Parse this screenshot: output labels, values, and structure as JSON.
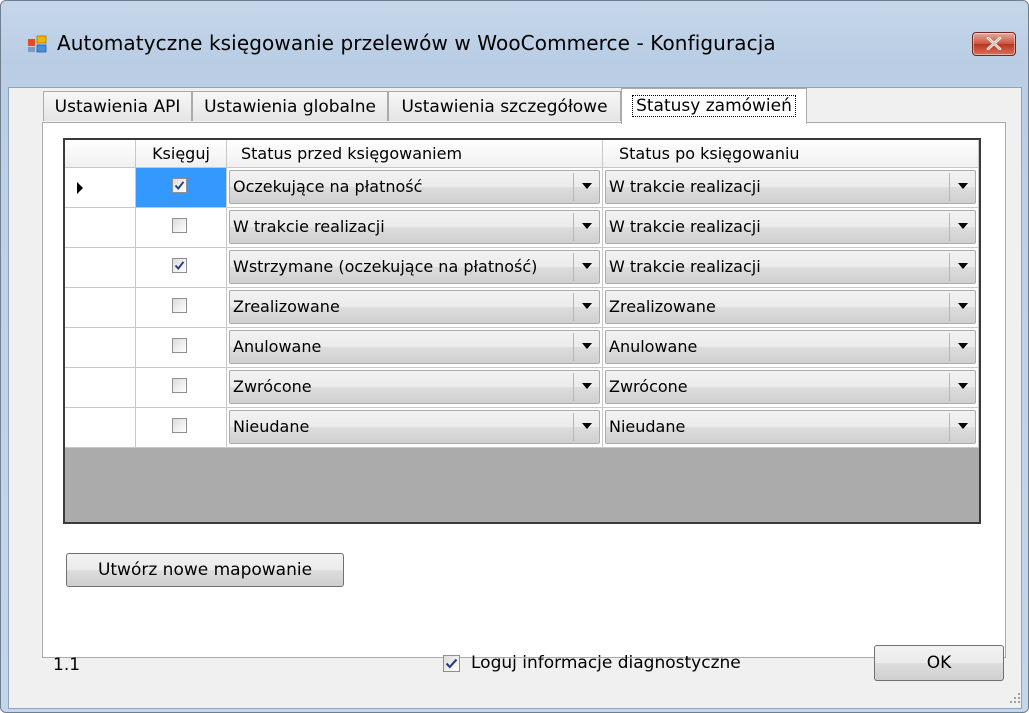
{
  "window": {
    "title": "Automatyczne księgowanie przelewów w WooCommerce - Konfiguracja",
    "icon": "app-window-icon",
    "close_icon": "close-icon"
  },
  "tabs": [
    {
      "label": "Ustawienia API",
      "active": false
    },
    {
      "label": "Ustawienia globalne",
      "active": false
    },
    {
      "label": "Ustawienia szczegółowe",
      "active": false
    },
    {
      "label": "Statusy zamówień",
      "active": true
    }
  ],
  "grid": {
    "columns": {
      "book": "Księguj",
      "status_before": "Status przed księgowaniem",
      "status_after": "Status po księgowaniu"
    },
    "current_row_indicator": "row-pointer-icon",
    "rows": [
      {
        "book": true,
        "before": "Oczekujące na płatność",
        "after": "W trakcie realizacji"
      },
      {
        "book": false,
        "before": "W trakcie realizacji",
        "after": "W trakcie realizacji"
      },
      {
        "book": true,
        "before": "Wstrzymane (oczekujące na płatność)",
        "after": "W trakcie realizacji"
      },
      {
        "book": false,
        "before": "Zrealizowane",
        "after": "Zrealizowane"
      },
      {
        "book": false,
        "before": "Anulowane",
        "after": "Anulowane"
      },
      {
        "book": false,
        "before": "Zwrócone",
        "after": "Zwrócone"
      },
      {
        "book": false,
        "before": "Nieudane",
        "after": "Nieudane"
      }
    ]
  },
  "new_mapping_button": "Utwórz nowe mapowanie",
  "footer": {
    "version": "1.1",
    "diagnostics_label": "Loguj informacje diagnostyczne",
    "diagnostics_checked": true,
    "ok_label": "OK"
  },
  "colors": {
    "selected_cell": "#3399ff",
    "grid_background": "#ababab",
    "title_bar": "#bdd0e6",
    "close_button": "#c9543e"
  }
}
